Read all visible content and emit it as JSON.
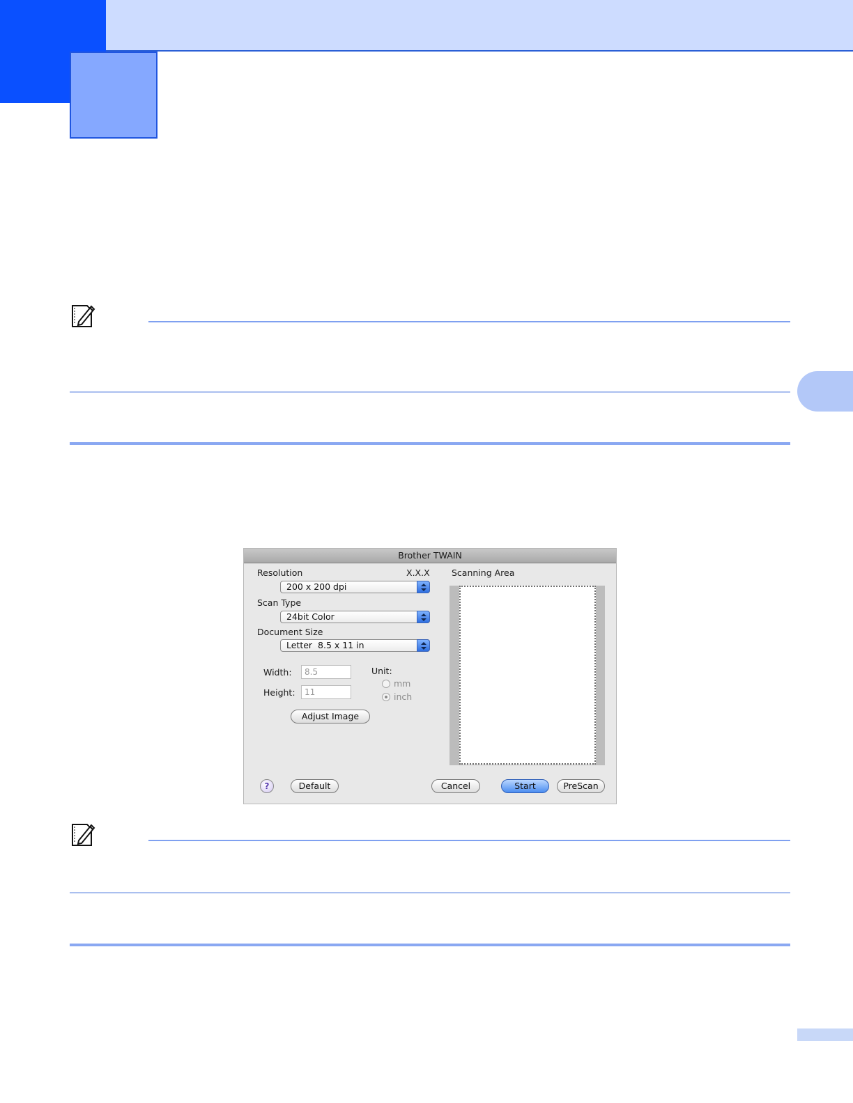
{
  "dialog": {
    "title": "Brother TWAIN",
    "resolution": {
      "label": "Resolution",
      "version": "X.X.X",
      "value": "200 x 200 dpi"
    },
    "scan_type": {
      "label": "Scan Type",
      "value": "24bit Color"
    },
    "document_size": {
      "label": "Document Size",
      "value": "Letter  8.5 x 11 in"
    },
    "width": {
      "label": "Width:",
      "value": "8.5"
    },
    "height": {
      "label": "Height:",
      "value": "11"
    },
    "unit": {
      "label": "Unit:",
      "options": [
        "mm",
        "inch"
      ],
      "selected": "inch"
    },
    "adjust_image_label": "Adjust Image",
    "scanning_area_label": "Scanning Area",
    "buttons": {
      "help": "?",
      "default": "Default",
      "cancel": "Cancel",
      "start": "Start",
      "prescan": "PreScan"
    }
  }
}
